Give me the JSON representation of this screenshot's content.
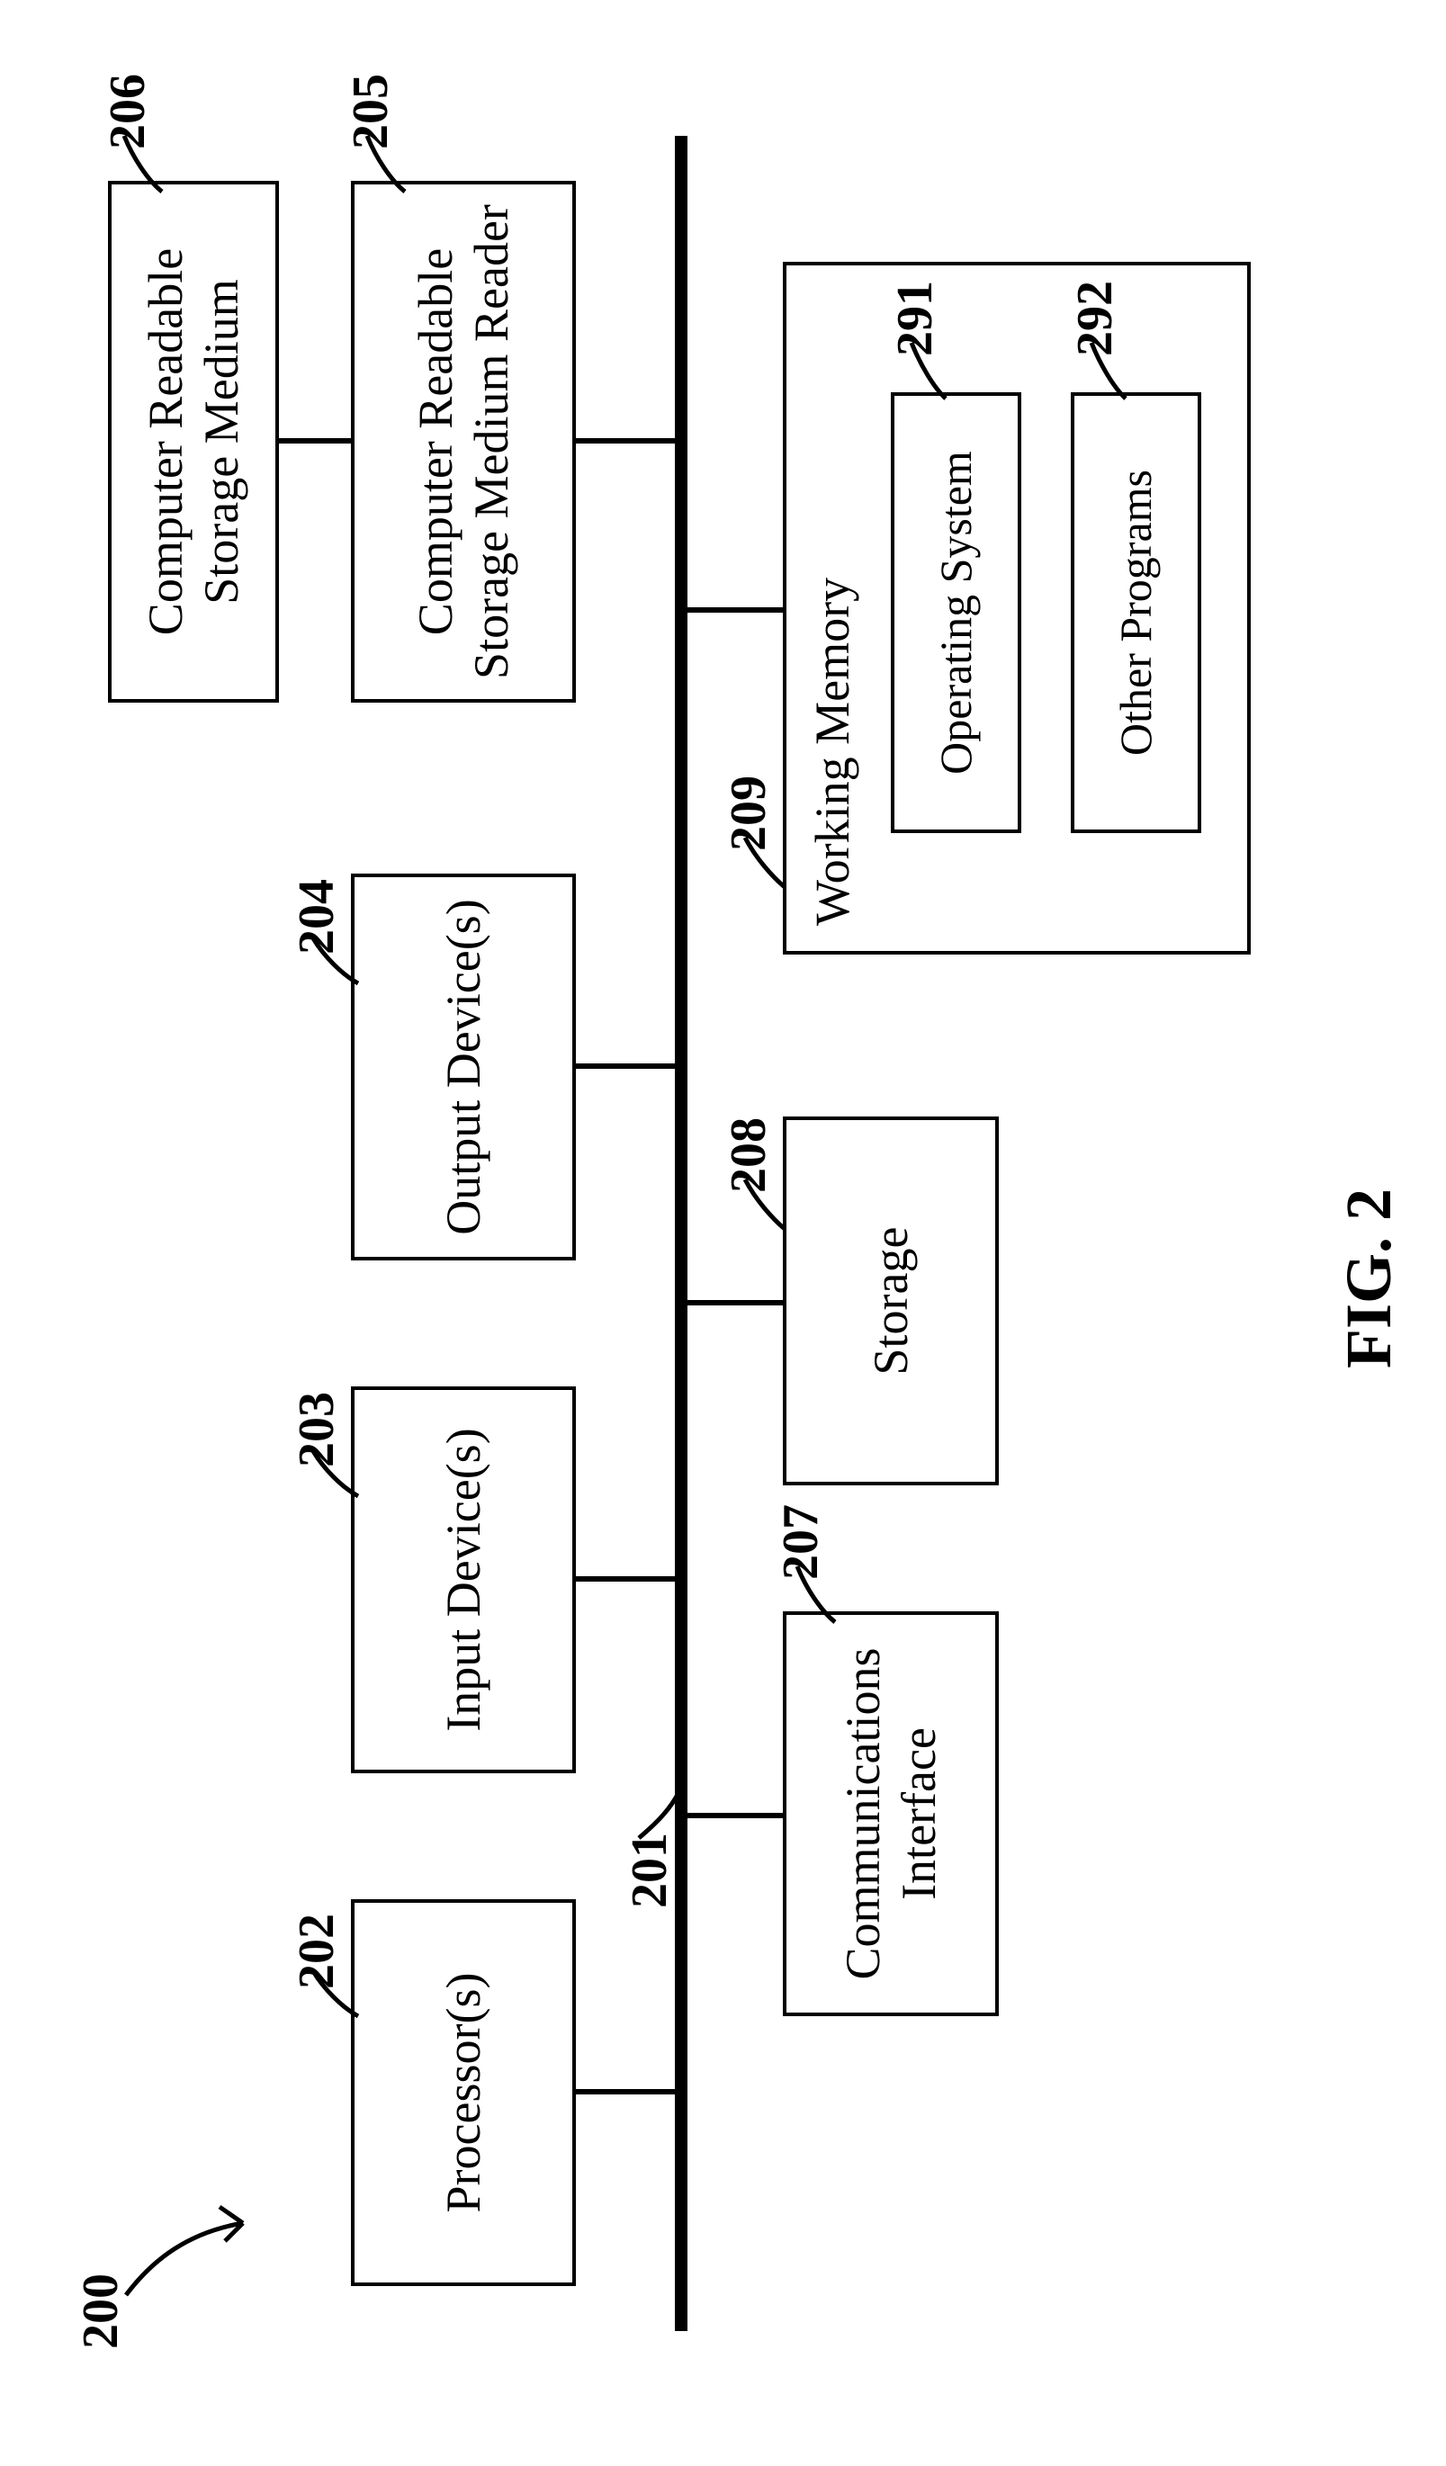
{
  "figure_label": "FIG. 2",
  "refs": {
    "system": "200",
    "bus": "201",
    "processor": "202",
    "input": "203",
    "output": "204",
    "reader": "205",
    "medium": "206",
    "comm": "207",
    "storage": "208",
    "memory": "209",
    "os": "291",
    "programs": "292"
  },
  "labels": {
    "processor": "Processor(s)",
    "input": "Input Device(s)",
    "output": "Output Device(s)",
    "reader": "Computer Readable Storage Medium Reader",
    "medium": "Computer Readable Storage Medium",
    "comm": "Communications Interface",
    "storage": "Storage",
    "memory": "Working Memory",
    "os": "Operating System",
    "programs": "Other Programs"
  }
}
